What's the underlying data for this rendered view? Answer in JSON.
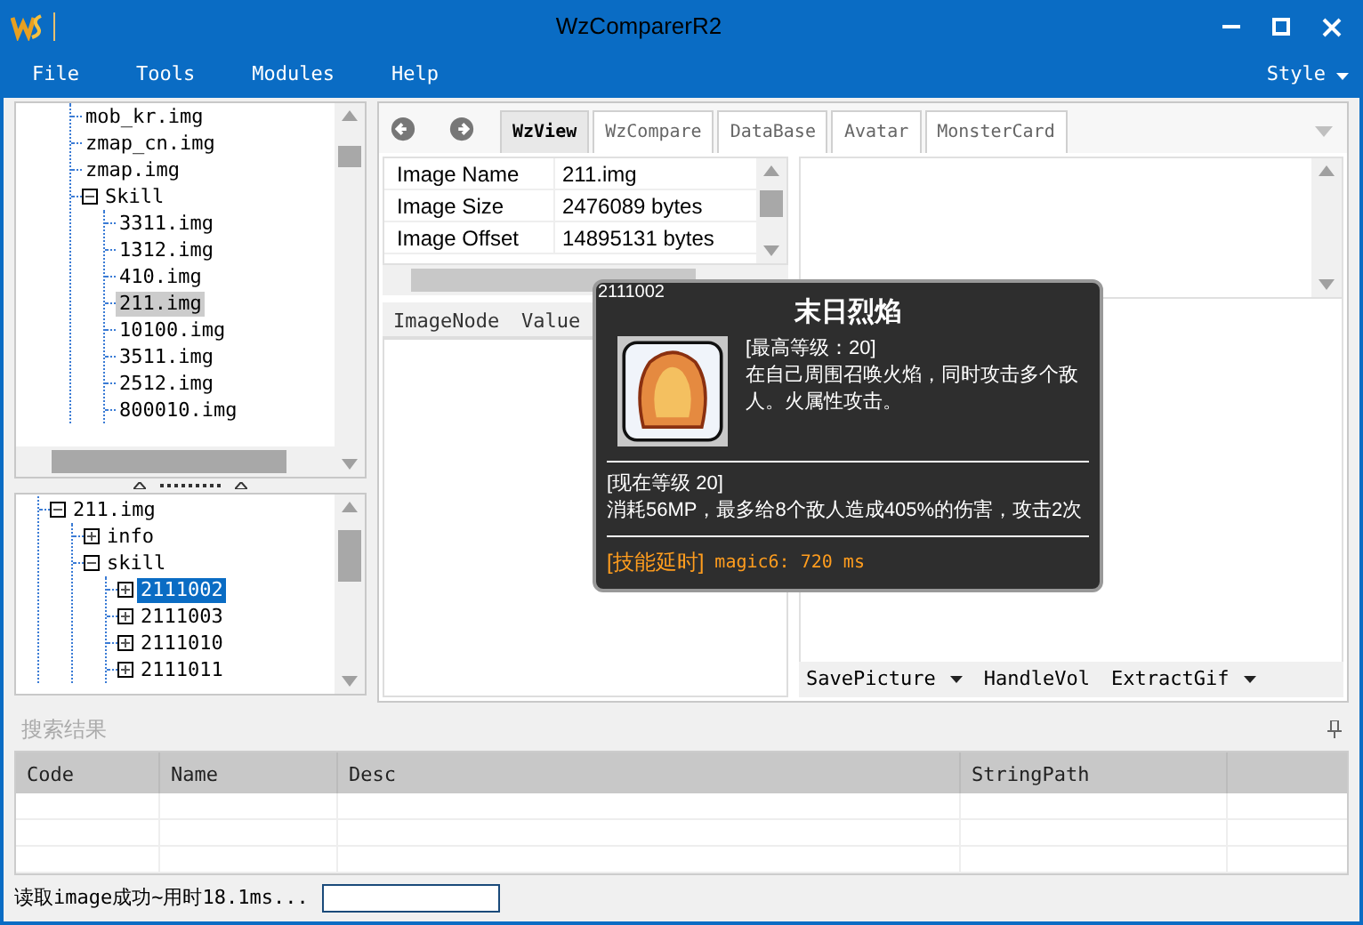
{
  "window": {
    "title": "WzComparerR2"
  },
  "menu": [
    {
      "label": "File"
    },
    {
      "label": "Tools"
    },
    {
      "label": "Modules"
    },
    {
      "label": "Help"
    }
  ],
  "style_menu": {
    "label": "Style"
  },
  "file_tree": {
    "items": [
      {
        "label": "mob_kr.img",
        "selected": false
      },
      {
        "label": "zmap_cn.img",
        "selected": false
      },
      {
        "label": "zmap.img",
        "selected": false
      },
      {
        "label": "Skill",
        "selected": false,
        "expanded": true,
        "children": [
          {
            "label": "3311.img",
            "selected": false
          },
          {
            "label": "1312.img",
            "selected": false
          },
          {
            "label": "410.img",
            "selected": false
          },
          {
            "label": "211.img",
            "selected": true
          },
          {
            "label": "10100.img",
            "selected": false
          },
          {
            "label": "3511.img",
            "selected": false
          },
          {
            "label": "2512.img",
            "selected": false
          },
          {
            "label": "800010.img",
            "selected": false
          }
        ]
      }
    ]
  },
  "node_tree": {
    "items": [
      {
        "label": "211.img",
        "selected": false,
        "expanded": true,
        "children": [
          {
            "label": "info",
            "selected": false,
            "expanded": false
          },
          {
            "label": "skill",
            "selected": false,
            "expanded": true,
            "children": [
              {
                "label": "2111002",
                "selected": true,
                "expanded": false
              },
              {
                "label": "2111003",
                "selected": false,
                "expanded": false
              },
              {
                "label": "2111010",
                "selected": false,
                "expanded": false
              },
              {
                "label": "2111011",
                "selected": false,
                "expanded": false
              }
            ]
          }
        ]
      }
    ]
  },
  "tabs": [
    {
      "label": "WzView",
      "selected": true
    },
    {
      "label": "WzCompare",
      "selected": false
    },
    {
      "label": "DataBase",
      "selected": false
    },
    {
      "label": "Avatar",
      "selected": false
    },
    {
      "label": "MonsterCard",
      "selected": false
    }
  ],
  "properties": [
    {
      "name": "Image Name",
      "value": "211.img"
    },
    {
      "name": "Image Size",
      "value": "2476089 bytes"
    },
    {
      "name": "Image Offset",
      "value": "14895131 bytes"
    }
  ],
  "node_grid": {
    "columns": [
      "ImageNode",
      "Value"
    ]
  },
  "tooltip": {
    "id": "2111002",
    "title": "末日烈焰",
    "max_level": "[最高等级：20]",
    "description": "在自己周围召唤火焰，同时攻击多个敌人。火属性攻击。",
    "current_level": "[现在等级 20]",
    "effect": "消耗56MP，最多给8个敌人造成405%的伤害，攻击2次",
    "delay_label": "[技能延时]",
    "delay_value": "magic6: 720 ms"
  },
  "toolbar": [
    {
      "label": "SavePicture",
      "kind": "dropdown"
    },
    {
      "label": "HandleVol",
      "kind": "button"
    },
    {
      "label": "ExtractGif",
      "kind": "dropdown"
    }
  ],
  "search": {
    "title": "搜索结果",
    "columns": [
      "Code",
      "Name",
      "Desc",
      "StringPath"
    ]
  },
  "status_bar": {
    "text": "读取image成功~用时18.1ms..."
  }
}
